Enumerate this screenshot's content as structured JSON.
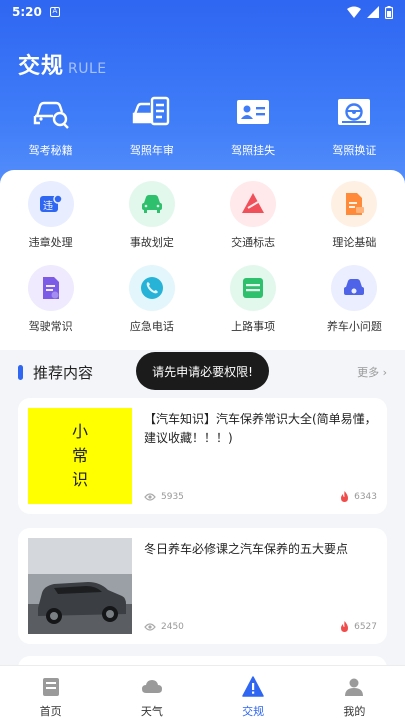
{
  "status": {
    "time": "5:20",
    "sim_icon": "A"
  },
  "header": {
    "title": "交规",
    "subtitle": "RULE"
  },
  "top_actions": [
    {
      "label": "驾考秘籍",
      "icon": "car-search-icon"
    },
    {
      "label": "驾照年审",
      "icon": "car-document-icon"
    },
    {
      "label": "驾照挂失",
      "icon": "id-card-icon"
    },
    {
      "label": "驾照换证",
      "icon": "license-wheel-icon"
    }
  ],
  "grid_items": [
    {
      "label": "违章处理",
      "icon": "violation-icon",
      "bg": "#e8eeff",
      "fg": "#2f66f2"
    },
    {
      "label": "事故划定",
      "icon": "accident-car-icon",
      "bg": "#e3f8ec",
      "fg": "#2ec06c"
    },
    {
      "label": "交通标志",
      "icon": "traffic-sign-icon",
      "bg": "#ffe9ea",
      "fg": "#f0505a"
    },
    {
      "label": "理论基础",
      "icon": "theory-doc-icon",
      "bg": "#fff0e4",
      "fg": "#ff8a3a"
    },
    {
      "label": "驾驶常识",
      "icon": "driving-knowledge-icon",
      "bg": "#efeafd",
      "fg": "#7c5ce6"
    },
    {
      "label": "应急电话",
      "icon": "phone-icon",
      "bg": "#e3f6fb",
      "fg": "#27b3d7"
    },
    {
      "label": "上路事项",
      "icon": "road-notes-icon",
      "bg": "#e3f8ec",
      "fg": "#2ec06c"
    },
    {
      "label": "养车小问题",
      "icon": "car-care-icon",
      "bg": "#ebeeff",
      "fg": "#4e63e8"
    }
  ],
  "section": {
    "title": "推荐内容",
    "more": "更多 ›"
  },
  "toast": "请先申请必要权限!",
  "articles": [
    {
      "thumb_text": [
        "小",
        "常",
        "识"
      ],
      "title": "【汽车知识】汽车保养常识大全(简单易懂，建议收藏！！！)",
      "views": "5935",
      "hot": "6343"
    },
    {
      "title": "冬日养车必修课之汽车保养的五大要点",
      "views": "2450",
      "hot": "6527"
    }
  ],
  "tabbar": [
    {
      "label": "首页",
      "icon": "home-icon",
      "active": false
    },
    {
      "label": "天气",
      "icon": "cloud-icon",
      "active": false
    },
    {
      "label": "交规",
      "icon": "warning-icon",
      "active": true
    },
    {
      "label": "我的",
      "icon": "user-icon",
      "active": false
    }
  ],
  "colors": {
    "primary": "#2f66f2",
    "hot": "#f04c4c"
  }
}
